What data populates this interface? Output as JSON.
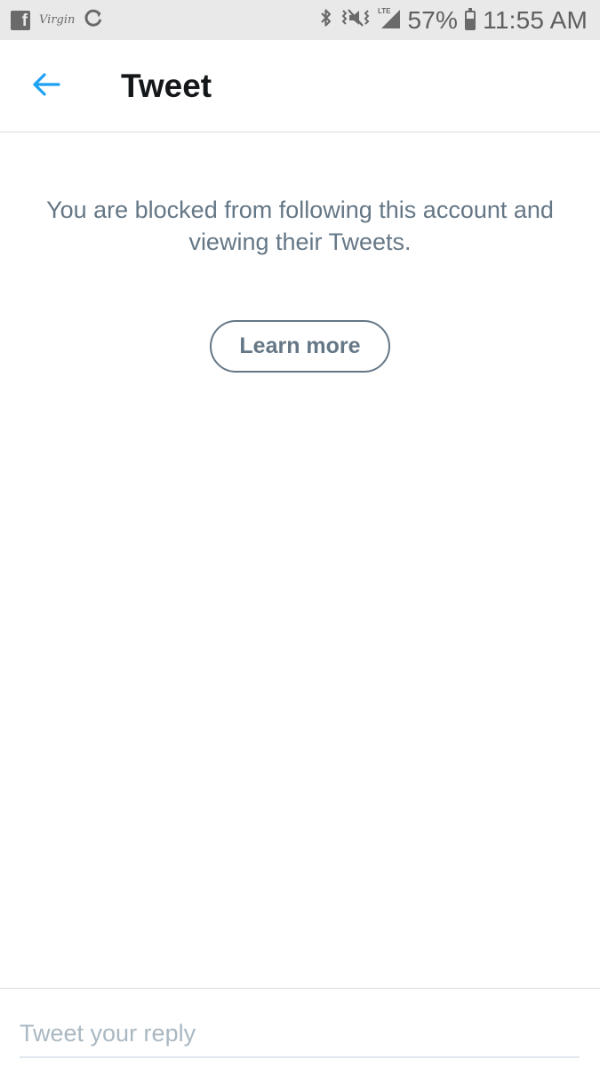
{
  "status_bar": {
    "left_icons": [
      "facebook-icon",
      "virgin-mobile-logo",
      "sync-icon"
    ],
    "virgin_label": "Virgin",
    "right_icons": [
      "bluetooth-icon",
      "vibrate-icon",
      "lte-signal-icon",
      "battery-icon"
    ],
    "network_label": "LTE",
    "battery_percent": "57%",
    "battery_level": 0.57,
    "time": "11:55 AM"
  },
  "header": {
    "back_icon": "arrow-left-icon",
    "title": "Tweet"
  },
  "content": {
    "blocked_message": "You are blocked from following this account and viewing their Tweets.",
    "learn_more_label": "Learn more"
  },
  "reply": {
    "placeholder": "Tweet your reply",
    "value": ""
  },
  "colors": {
    "accent": "#1da1f2",
    "text_primary": "#14171a",
    "text_secondary": "#657786",
    "placeholder": "#aab8c2",
    "divider": "#d8dee3",
    "status_bar_bg": "#e9e9e9"
  }
}
